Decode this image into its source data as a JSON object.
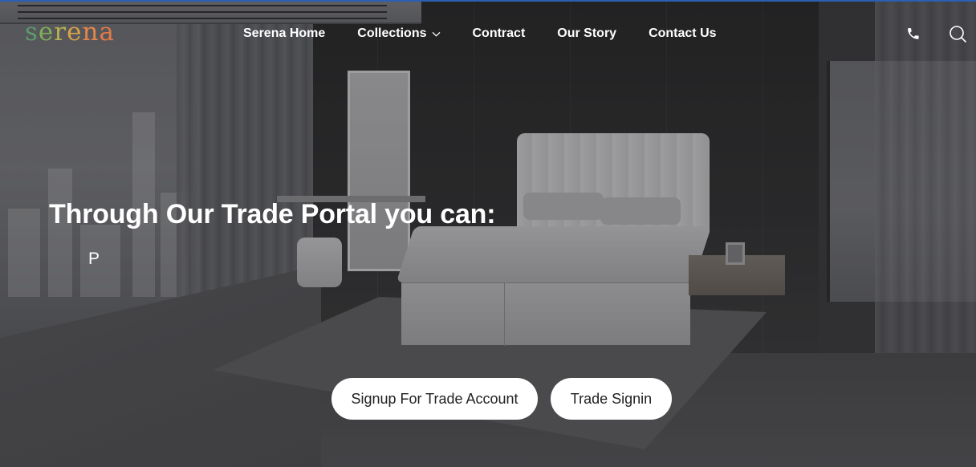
{
  "brand": {
    "logo_text": "serena",
    "logo_letters": [
      "s",
      "e",
      "r",
      "e",
      "n",
      "a"
    ],
    "logo_colors": [
      "#5c9a6e",
      "#7faf5a",
      "#b5b152",
      "#d9a24a",
      "#e3874a",
      "#e07a48"
    ]
  },
  "nav": {
    "items": [
      {
        "label": "Serena Home"
      },
      {
        "label": "Collections",
        "has_dropdown": true,
        "icon": "chevron-down-icon"
      },
      {
        "label": "Contract"
      },
      {
        "label": "Our Story"
      },
      {
        "label": "Contact Us"
      }
    ]
  },
  "header_icons": {
    "phone": "phone-icon",
    "search": "search-icon"
  },
  "hero": {
    "title": "Through Our Trade Portal you can:",
    "typing_text": "P",
    "buttons": {
      "signup": "Signup For Trade Account",
      "signin": "Trade Signin"
    }
  },
  "colors": {
    "accent_strip": "#2b5fb4",
    "button_bg": "#ffffff",
    "button_text": "#222222",
    "nav_text": "#ffffff"
  }
}
